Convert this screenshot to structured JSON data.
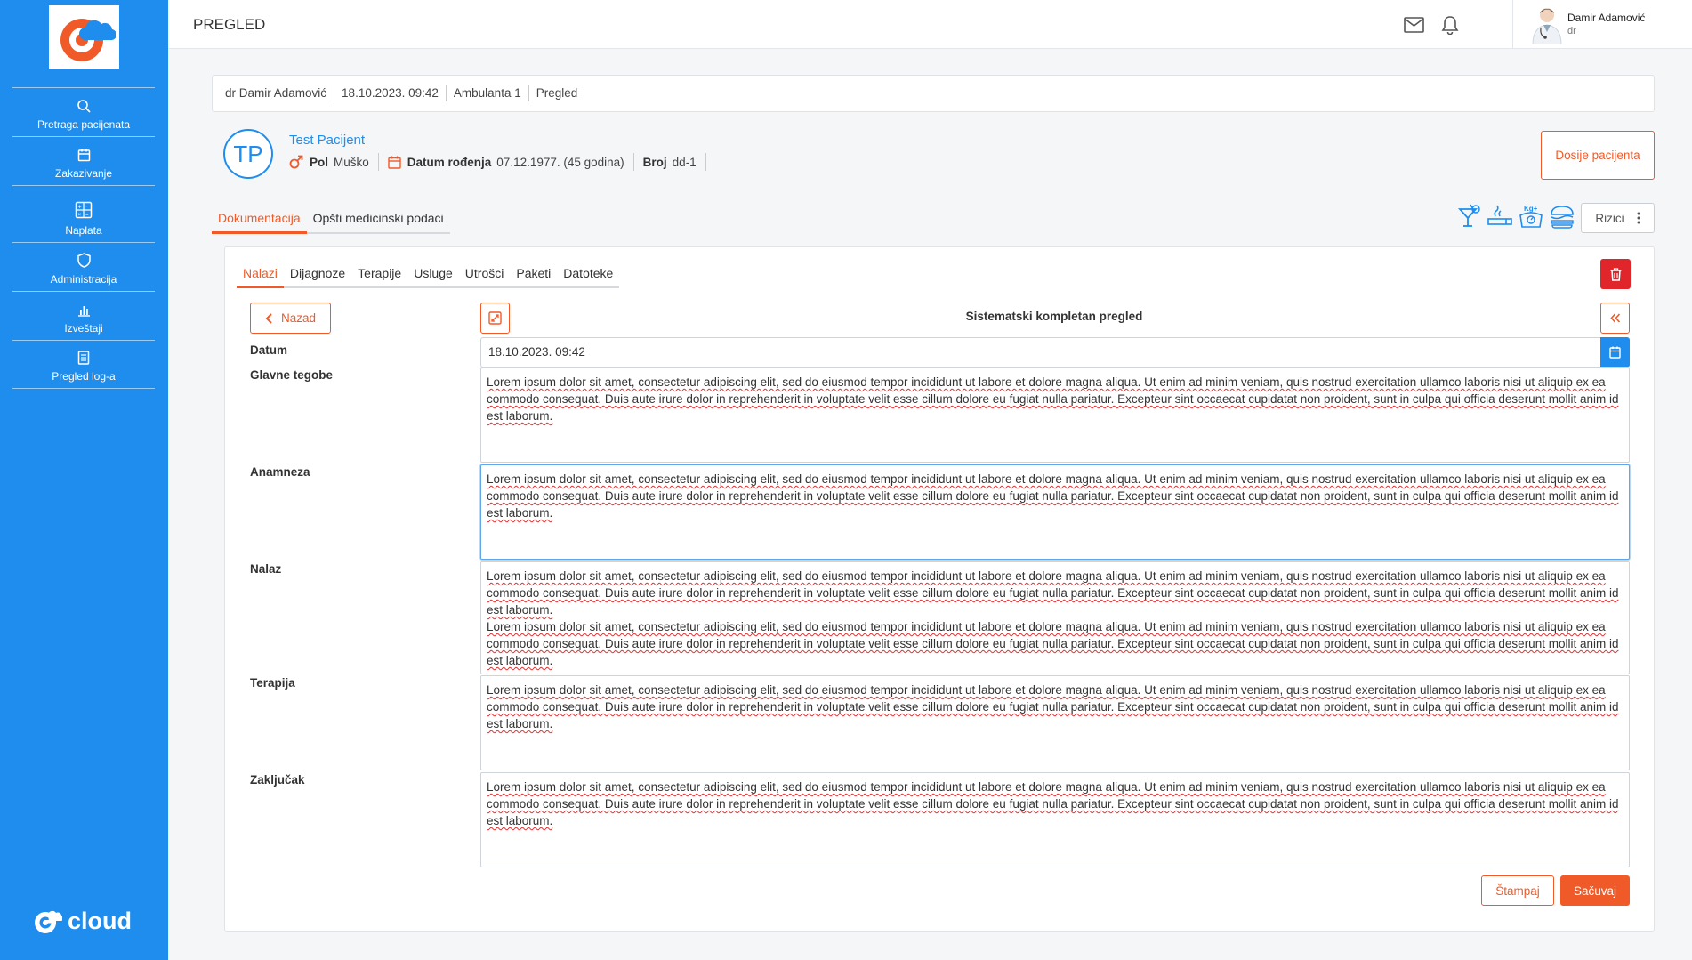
{
  "sidebar": {
    "items": [
      {
        "label": "Pretraga pacijenata",
        "icon": "search-icon"
      },
      {
        "label": "Zakazivanje",
        "icon": "calendar-icon"
      },
      {
        "label": "Naplata",
        "icon": "calculator-icon"
      },
      {
        "label": "Administracija",
        "icon": "shield-icon"
      },
      {
        "label": "Izveštaji",
        "icon": "bar-chart-icon"
      },
      {
        "label": "Pregled log-a",
        "icon": "document-icon"
      }
    ],
    "footer_logo_text": "cloud"
  },
  "header": {
    "title": "PREGLED",
    "user_name": "Damir Adamović",
    "user_role": "dr"
  },
  "breadcrumb": [
    "dr Damir Adamović",
    "18.10.2023. 09:42",
    "Ambulanta 1",
    "Pregled"
  ],
  "patient": {
    "initials": "TP",
    "name": "Test Pacijent",
    "gender_label": "Pol",
    "gender": "Muško",
    "dob_label": "Datum rođenja",
    "dob": "07.12.1977. (45 godina)",
    "number_label": "Broj",
    "number": "dd-1",
    "dosije_button": "Dosije pacijenta"
  },
  "top_tabs": [
    {
      "label": "Dokumentacija",
      "active": true
    },
    {
      "label": "Opšti medicinski podaci",
      "active": false
    }
  ],
  "rizici_button": "Rizici",
  "sub_tabs": [
    {
      "label": "Nalazi",
      "active": true
    },
    {
      "label": "Dijagnoze",
      "active": false
    },
    {
      "label": "Terapije",
      "active": false
    },
    {
      "label": "Usluge",
      "active": false
    },
    {
      "label": "Utrošci",
      "active": false
    },
    {
      "label": "Paketi",
      "active": false
    },
    {
      "label": "Datoteke",
      "active": false
    }
  ],
  "form": {
    "back_button": "Nazad",
    "title": "Sistematski kompletan pregled",
    "date_label": "Datum",
    "date_value": "18.10.2023. 09:42",
    "fields": {
      "glavne_tegobe": {
        "label": "Glavne tegobe",
        "paragraphs": [
          "Lorem ipsum dolor sit amet, consectetur adipiscing elit, sed do eiusmod tempor incididunt ut labore et dolore magna aliqua. Ut enim ad minim veniam, quis nostrud exercitation ullamco laboris nisi ut aliquip ex ea commodo consequat. Duis aute irure dolor in reprehenderit in voluptate velit esse cillum dolore eu fugiat nulla pariatur. Excepteur sint occaecat cupidatat non proident, sunt in culpa qui officia deserunt mollit anim id est laborum."
        ]
      },
      "anamneza": {
        "label": "Anamneza",
        "paragraphs": [
          "Lorem ipsum dolor sit amet, consectetur adipiscing elit, sed do eiusmod tempor incididunt ut labore et dolore magna aliqua. Ut enim ad minim veniam, quis nostrud exercitation ullamco laboris nisi ut aliquip ex ea commodo consequat. Duis aute irure dolor in reprehenderit in voluptate velit esse cillum dolore eu fugiat nulla pariatur. Excepteur sint occaecat cupidatat non proident, sunt in culpa qui officia deserunt mollit anim id est laborum."
        ]
      },
      "nalaz": {
        "label": "Nalaz",
        "paragraphs": [
          "Lorem ipsum dolor sit amet, consectetur adipiscing elit, sed do eiusmod tempor incididunt ut labore et dolore magna aliqua. Ut enim ad minim veniam, quis nostrud exercitation ullamco laboris nisi ut aliquip ex ea commodo consequat. Duis aute irure dolor in reprehenderit in voluptate velit esse cillum dolore eu fugiat nulla pariatur. Excepteur sint occaecat cupidatat non proident, sunt in culpa qui officia deserunt mollit anim id est laborum.",
          "Lorem ipsum dolor sit amet, consectetur adipiscing elit, sed do eiusmod tempor incididunt ut labore et dolore magna aliqua. Ut enim ad minim veniam, quis nostrud exercitation ullamco laboris nisi ut aliquip ex ea commodo consequat. Duis aute irure dolor in reprehenderit in voluptate velit esse cillum dolore eu fugiat nulla pariatur. Excepteur sint occaecat cupidatat non proident, sunt in culpa qui officia deserunt mollit anim id est laborum."
        ]
      },
      "terapija": {
        "label": "Terapija",
        "paragraphs": [
          "Lorem ipsum dolor sit amet, consectetur adipiscing elit, sed do eiusmod tempor incididunt ut labore et dolore magna aliqua. Ut enim ad minim veniam, quis nostrud exercitation ullamco laboris nisi ut aliquip ex ea commodo consequat. Duis aute irure dolor in reprehenderit in voluptate velit esse cillum dolore eu fugiat nulla pariatur. Excepteur sint occaecat cupidatat non proident, sunt in culpa qui officia deserunt mollit anim id est laborum."
        ]
      },
      "zakljucak": {
        "label": "Zaključak",
        "paragraphs": [
          "Lorem ipsum dolor sit amet, consectetur adipiscing elit, sed do eiusmod tempor incididunt ut labore et dolore magna aliqua. Ut enim ad minim veniam, quis nostrud exercitation ullamco laboris nisi ut aliquip ex ea commodo consequat. Duis aute irure dolor in reprehenderit in voluptate velit esse cillum dolore eu fugiat nulla pariatur. Excepteur sint occaecat cupidatat non proident, sunt in culpa qui officia deserunt mollit anim id est laborum."
        ]
      }
    },
    "print_button": "Štampaj",
    "save_button": "Sačuvaj"
  },
  "colors": {
    "sidebar_bg": "#1f8ded",
    "accent_orange": "#f05a28",
    "danger_red": "#e0262b",
    "primary_blue": "#1f8ded"
  }
}
